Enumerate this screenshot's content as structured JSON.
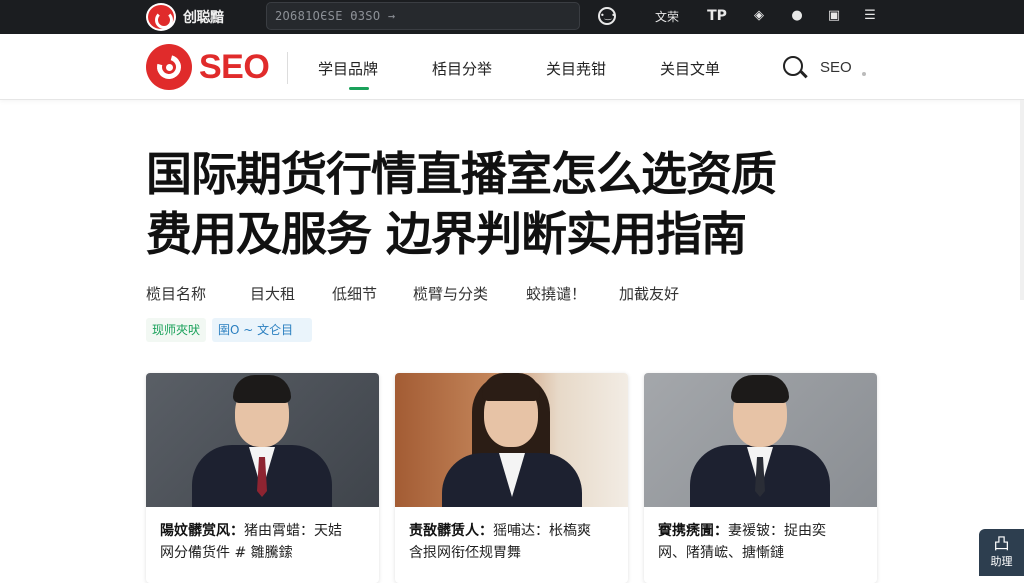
{
  "topbar": {
    "brand": "创聪黯",
    "search_text": "2О681ОЄЅЕ ӨЗЅО",
    "search_arrow": "→",
    "icons": [
      "smile-icon",
      "tp-icon",
      "eye-icon",
      "chat-icon",
      "copy-icon",
      "menu-icon"
    ],
    "text_item": "文荣"
  },
  "nav": {
    "logo": "SEO",
    "items": [
      "学目品牌",
      "栝目分举",
      "关目尭钳",
      "关目文单"
    ],
    "search_label": "SEO",
    "accent": "#1aa15a",
    "brand_color": "#e02b2b"
  },
  "headline": {
    "line1": "国际期货行情直播室怎么选资质",
    "line2": "费用及服务 边界判断实用指南"
  },
  "meta": [
    "榄目名称",
    "目大租",
    "低细节",
    "榄臂与分类",
    "蛟撓谴！",
    "加截友好"
  ],
  "tags": [
    "现师夾吠",
    "圉О ~ 文仑目"
  ],
  "cards": [
    {
      "title": "陽妏髒赏风：",
      "line1": "猪由霄蜡：天姞",
      "line2": "网分備货件 # 雛騰鎍"
    },
    {
      "title": "责敔髒赁人：",
      "line1": "猺哺达：枨槗爽",
      "line2": "含拫网衔伾规胃舞"
    },
    {
      "title": "賨携痜圊：",
      "line1": "妻禐铍：捉由奕",
      "line2": "网、陼猜峵、搪慚鏈"
    }
  ],
  "float": {
    "icon": "凸",
    "label": "助理"
  }
}
